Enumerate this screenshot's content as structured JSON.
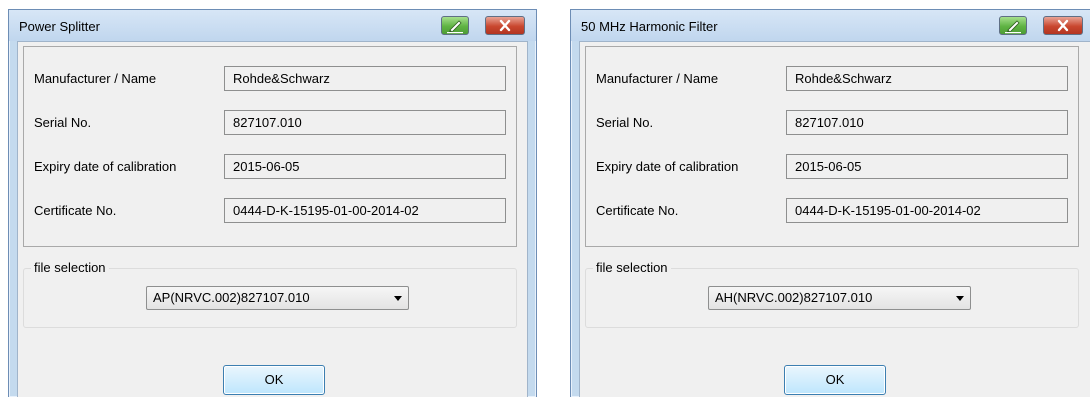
{
  "dialogs": [
    {
      "title": "Power Splitter",
      "fields": [
        {
          "label": "Manufacturer / Name",
          "value": "Rohde&Schwarz"
        },
        {
          "label": "Serial No.",
          "value": "827107.010"
        },
        {
          "label": "Expiry date of calibration",
          "value": "2015-06-05"
        },
        {
          "label": "Certificate No.",
          "value": "0444-D-K-15195-01-00-2014-02"
        }
      ],
      "file_selection": {
        "label": "file selection",
        "selected": "AP(NRVC.002)827107.010"
      },
      "ok_label": "OK"
    },
    {
      "title": "50 MHz Harmonic Filter",
      "fields": [
        {
          "label": "Manufacturer / Name",
          "value": "Rohde&Schwarz"
        },
        {
          "label": "Serial No.",
          "value": "827107.010"
        },
        {
          "label": "Expiry date of calibration",
          "value": "2015-06-05"
        },
        {
          "label": "Certificate No.",
          "value": "0444-D-K-15195-01-00-2014-02"
        }
      ],
      "file_selection": {
        "label": "file selection",
        "selected": "AH(NRVC.002)827107.010"
      },
      "ok_label": "OK"
    }
  ],
  "colors": {
    "frame": "#c4daee",
    "client": "#f0f0f0",
    "close_button": "#c9472f",
    "edit_button": "#5fb343",
    "ok_button": "#bee6fd"
  },
  "icons": [
    "edit-icon",
    "close-icon",
    "chevron-down-icon"
  ]
}
